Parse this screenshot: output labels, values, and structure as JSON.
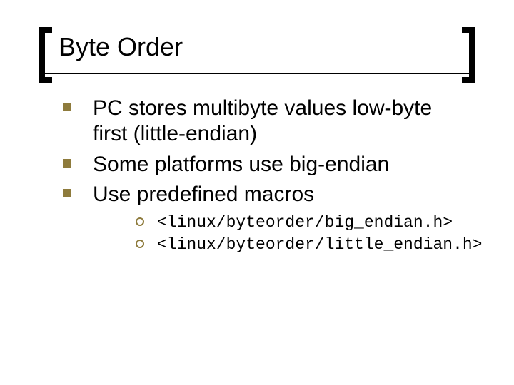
{
  "title": "Byte Order",
  "bullets": {
    "level1": [
      "PC stores multibyte values low-byte first (little-endian)",
      "Some platforms use big-endian",
      "Use predefined macros"
    ],
    "level2": [
      "<linux/byteorder/big_endian.h>",
      "<linux/byteorder/little_endian.h>"
    ]
  },
  "colors": {
    "accent": "#8e7b3c",
    "text": "#000000",
    "background": "#ffffff"
  }
}
